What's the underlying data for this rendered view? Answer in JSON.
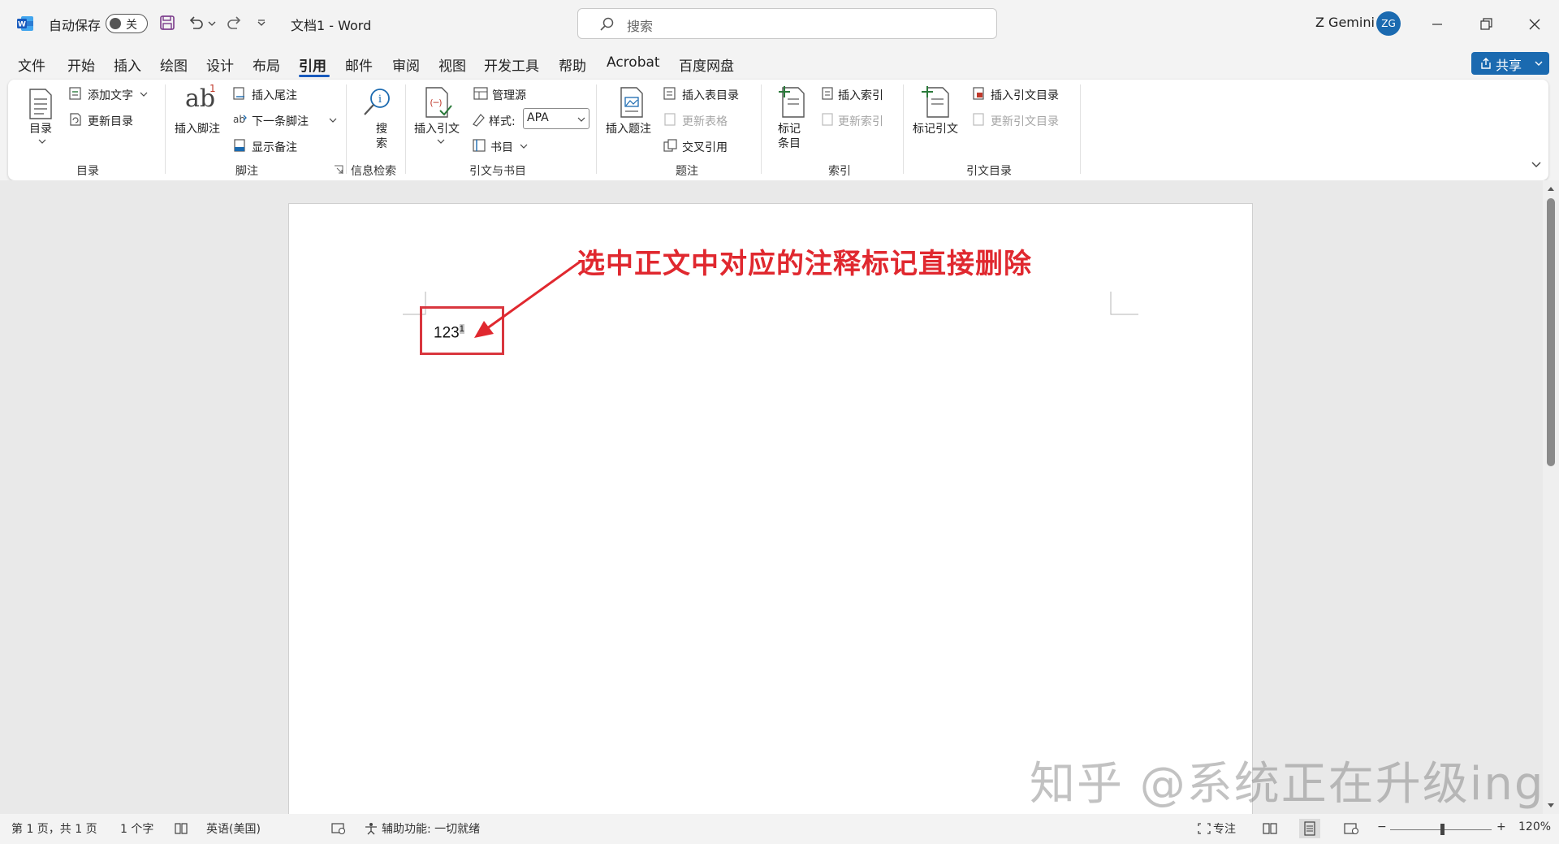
{
  "titlebar": {
    "autosave_label": "自动保存",
    "autosave_state": "关",
    "doc_title": "文档1  -  Word",
    "search_placeholder": "搜索",
    "user_name": "Z Gemini",
    "avatar_initials": "ZG"
  },
  "menu": {
    "items": [
      "文件",
      "开始",
      "插入",
      "绘图",
      "设计",
      "布局",
      "引用",
      "邮件",
      "审阅",
      "视图",
      "开发工具",
      "帮助",
      "Acrobat",
      "百度网盘"
    ],
    "active": "引用",
    "share_label": "共享"
  },
  "ribbon": {
    "toc": {
      "big": "目录",
      "add_text": "添加文字",
      "update": "更新目录",
      "label": "目录"
    },
    "footnotes": {
      "insert": "插入脚注",
      "insert_endnote": "插入尾注",
      "next": "下一条脚注",
      "show": "显示备注",
      "label": "脚注",
      "ab_glyph": "ab",
      "ab_superscript": "1"
    },
    "research": {
      "search_line1": "搜",
      "search_line2": "索",
      "label": "信息检索"
    },
    "citations": {
      "insert": "插入引文",
      "manage": "管理源",
      "style_label": "样式:",
      "style_value": "APA",
      "bibliography": "书目",
      "label": "引文与书目"
    },
    "captions": {
      "insert": "插入题注",
      "insert_table_of_figures": "插入表目录",
      "update_table": "更新表格",
      "cross_ref": "交叉引用",
      "label": "题注"
    },
    "index": {
      "mark_line1": "标记",
      "mark_line2": "条目",
      "insert": "插入索引",
      "update": "更新索引",
      "label": "索引"
    },
    "toa": {
      "mark": "标记引文",
      "insert": "插入引文目录",
      "update": "更新引文目录",
      "label": "引文目录"
    }
  },
  "document": {
    "text": "123",
    "footnote_mark": "1",
    "annotation": "选中正文中对应的注释标记直接删除"
  },
  "watermark": "知乎 @系统正在升级ing",
  "statusbar": {
    "page": "第 1 页，共 1 页",
    "words": "1 个字",
    "language": "英语(美国)",
    "accessibility": "辅助功能: 一切就绪",
    "focus": "专注",
    "zoom_minus": "−",
    "zoom_plus": "+",
    "zoom": "120%"
  },
  "colors": {
    "accent": "#185abd",
    "annotation_red": "#e0282f",
    "share_blue": "#1b6ab0"
  }
}
